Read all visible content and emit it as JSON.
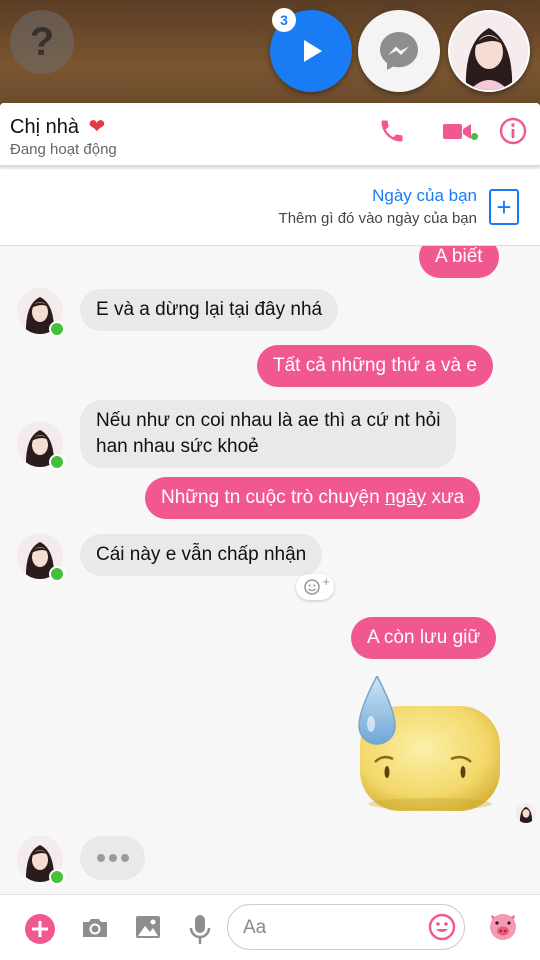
{
  "overlay": {
    "help_glyph": "?",
    "unread_count": "3",
    "chatheads": [
      {
        "name": "play-icon"
      },
      {
        "name": "messenger-icon"
      },
      {
        "name": "contact-avatar"
      }
    ]
  },
  "header": {
    "contact_name": "Chị nhà",
    "heart": "❤",
    "status": "Đang hoạt động",
    "icons": [
      "phone-icon",
      "video-camera-icon",
      "info-icon"
    ],
    "accent_color": "#f1588f"
  },
  "story": {
    "title": "Ngày của bạn",
    "subtitle": "Thêm gì đó vào ngày của bạn",
    "add_glyph": "+"
  },
  "messages": [
    {
      "side": "out",
      "text": "A biết"
    },
    {
      "side": "in",
      "text": "E và a dừng lại tại đây nhá"
    },
    {
      "side": "out",
      "text": "Tất cả những thứ a và e"
    },
    {
      "side": "in",
      "line1": "Nếu như cn coi nhau là ae thì a cứ nt hỏi",
      "line2": "han nhau sức khoẻ"
    },
    {
      "side": "out",
      "text_before": "Những tn cuộc trò chuyện ",
      "text_underlined": "ngày",
      "text_after": " xưa"
    },
    {
      "side": "in",
      "text": "Cái này e vẫn chấp nhận"
    },
    {
      "side": "out",
      "text": "A còn lưu giữ"
    },
    {
      "side": "out",
      "sticker": "cold-sweat-sticker"
    }
  ],
  "reaction_add": "+",
  "typing_indicator": true,
  "composer": {
    "placeholder": "Aa",
    "icons": [
      "plus-icon",
      "camera-icon",
      "image-icon",
      "microphone-icon",
      "emoji-icon",
      "pig-sticker-icon"
    ]
  },
  "colors": {
    "outgoing_bubble": "#f1588f",
    "incoming_bubble": "#e9e9e9",
    "link_blue": "#1a7cf5",
    "online_green": "#44c03d"
  }
}
